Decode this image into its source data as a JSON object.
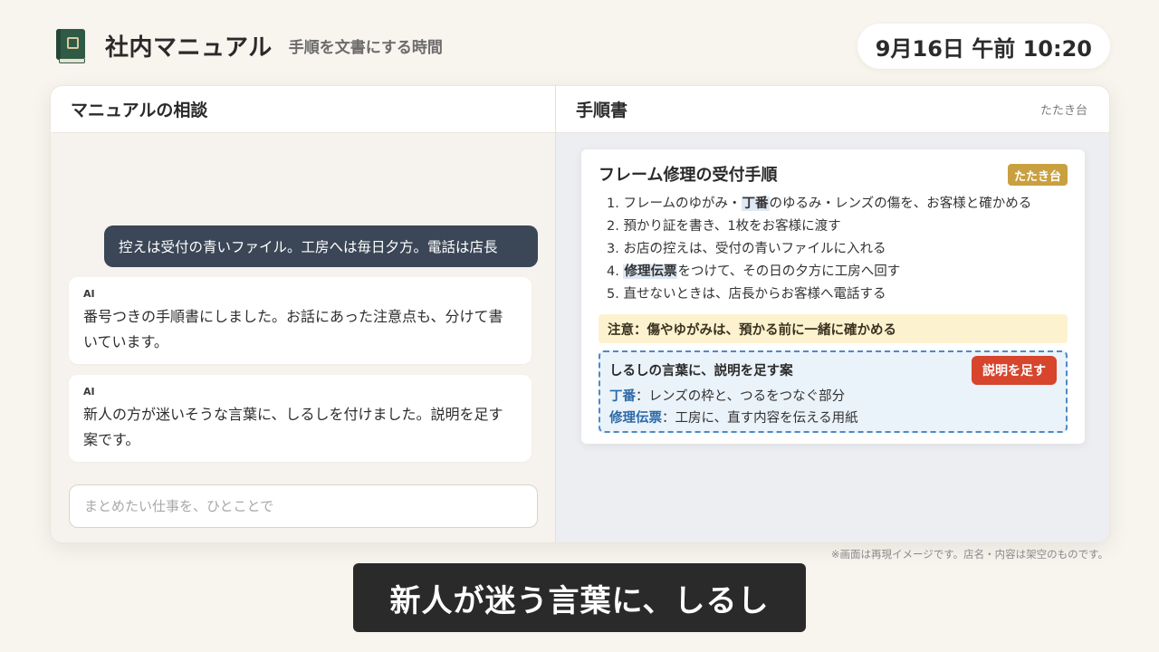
{
  "app": {
    "title": "社内マニュアル",
    "subtitle": "手順を文書にする時間",
    "icon": "book-icon"
  },
  "clock": {
    "text": "9月16日 午前 10:20"
  },
  "chat": {
    "title": "マニュアルの相談",
    "user_message": "控えは受付の青いファイル。工房へは毎日夕方。電話は店長",
    "messages": [
      {
        "sender": "AI",
        "text": "番号つきの手順書にしました。お話にあった注意点も、分けて書いています。"
      },
      {
        "sender": "AI",
        "text": "新人の方が迷いそうな言葉に、しるしを付けました。説明を足す案です。"
      }
    ],
    "input": {
      "value": "",
      "placeholder": "まとめたい仕事を、ひとことで"
    }
  },
  "document": {
    "pane_title": "手順書",
    "location_tag": "たたき台",
    "title": "フレーム修理の受付手順",
    "badge": "たたき台",
    "steps": [
      {
        "num": "1.",
        "before": "フレームのゆがみ・",
        "term": "丁番",
        "after": "のゆるみ・レンズの傷を、お客様と確かめる"
      },
      {
        "num": "2.",
        "before": "預かり証を書き、1枚をお客様に渡す",
        "term": "",
        "after": ""
      },
      {
        "num": "3.",
        "before": "お店の控えは、受付の青いファイルに入れる",
        "term": "",
        "after": ""
      },
      {
        "num": "4.",
        "before": "",
        "term": "修理伝票",
        "after": "をつけて、その日の夕方に工房へ回す"
      },
      {
        "num": "5.",
        "before": "直せないときは、店長からお客様へ電話する",
        "term": "",
        "after": ""
      }
    ],
    "caution": "注意：傷やゆがみは、預かる前に一緒に確かめる",
    "suggestion": {
      "title": "しるしの言葉に、説明を足す案",
      "button": "説明を足す",
      "terms": [
        {
          "term": "丁番",
          "definition": "：レンズの枠と、つるをつなぐ部分"
        },
        {
          "term": "修理伝票",
          "definition": "：工房に、直す内容を伝える用紙"
        }
      ]
    }
  },
  "disclaimer": "※画面は再現イメージです。店名・内容は架空のものです。",
  "caption": "新人が迷う言葉に、しるし",
  "colors": {
    "background": "#f8f4ee",
    "user_bubble": "#3b4657",
    "badge": "#c9a040",
    "accent_red": "#d6452c",
    "term_blue": "#2b6aa8",
    "caution_bg": "#fdf2cf"
  }
}
